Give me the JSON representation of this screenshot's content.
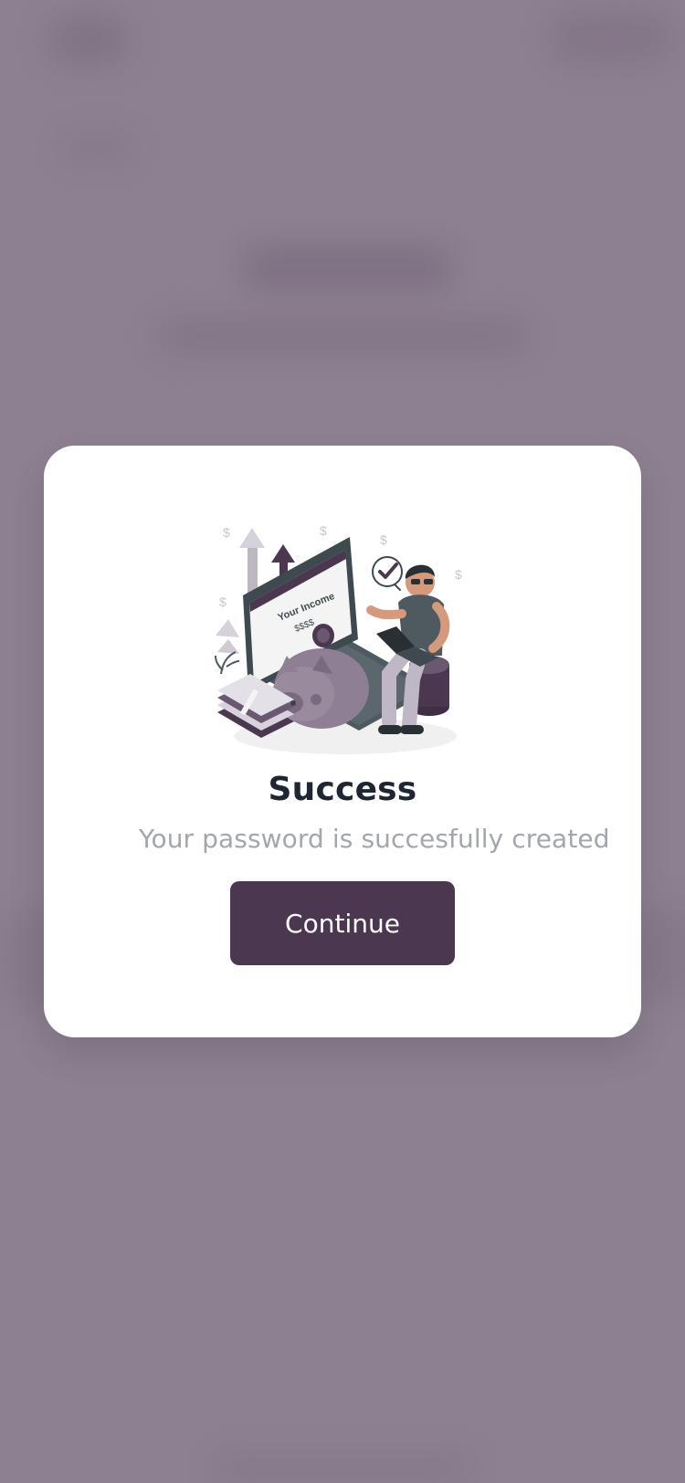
{
  "modal": {
    "title": "Success",
    "subtitle": "Your password is succesfully created",
    "continue_label": "Continue"
  },
  "illustration": {
    "income_label": "Your Income",
    "income_value": "$$$$"
  },
  "colors": {
    "overlay": "#8d8191",
    "modal_bg": "#ffffff",
    "primary": "#4b3850",
    "title_text": "#1f2633",
    "subtitle_text": "#a3a6ad"
  },
  "icons": [
    "check-circle-icon",
    "coin-icon",
    "dollar-sign-icon",
    "arrow-up-icon"
  ]
}
